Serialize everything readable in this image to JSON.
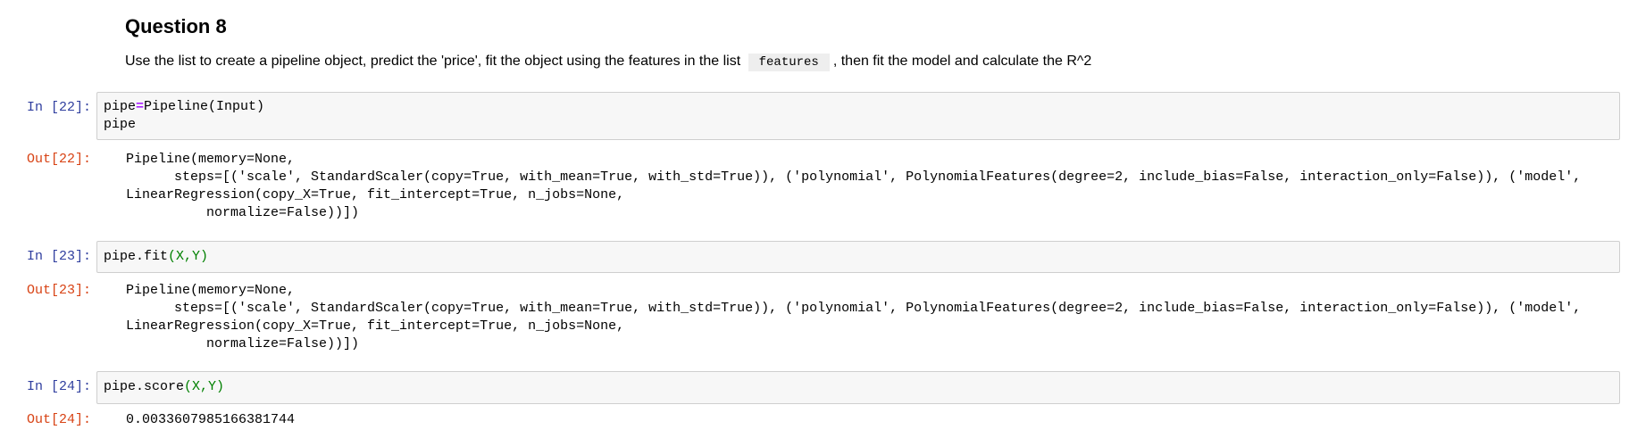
{
  "markdown": {
    "heading": "Question 8",
    "para_before": "Use the list to create a pipeline object, predict the 'price', fit the object using the features in the list",
    "para_code": "features",
    "para_after": ", then fit the model and calculate the R^2"
  },
  "cells": [
    {
      "in_prompt": "In [22]:",
      "code": {
        "line1_a": "pipe",
        "line1_op": "=",
        "line1_b": "Pipeline(Input)",
        "line2": "pipe"
      },
      "out_prompt": "Out[22]:",
      "output": "Pipeline(memory=None,\n      steps=[('scale', StandardScaler(copy=True, with_mean=True, with_std=True)), ('polynomial', PolynomialFeatures(degree=2, include_bias=False, interaction_only=False)), ('model',\nLinearRegression(copy_X=True, fit_intercept=True, n_jobs=None,\n          normalize=False))])"
    },
    {
      "in_prompt": "In [23]:",
      "code": {
        "prefix": "pipe.fit",
        "args": "(X,Y)"
      },
      "out_prompt": "Out[23]:",
      "output": "Pipeline(memory=None,\n      steps=[('scale', StandardScaler(copy=True, with_mean=True, with_std=True)), ('polynomial', PolynomialFeatures(degree=2, include_bias=False, interaction_only=False)), ('model',\nLinearRegression(copy_X=True, fit_intercept=True, n_jobs=None,\n          normalize=False))])"
    },
    {
      "in_prompt": "In [24]:",
      "code": {
        "prefix": "pipe.score",
        "args": "(X,Y)"
      },
      "out_prompt": "Out[24]:",
      "output": "0.0033607985166381744"
    }
  ]
}
